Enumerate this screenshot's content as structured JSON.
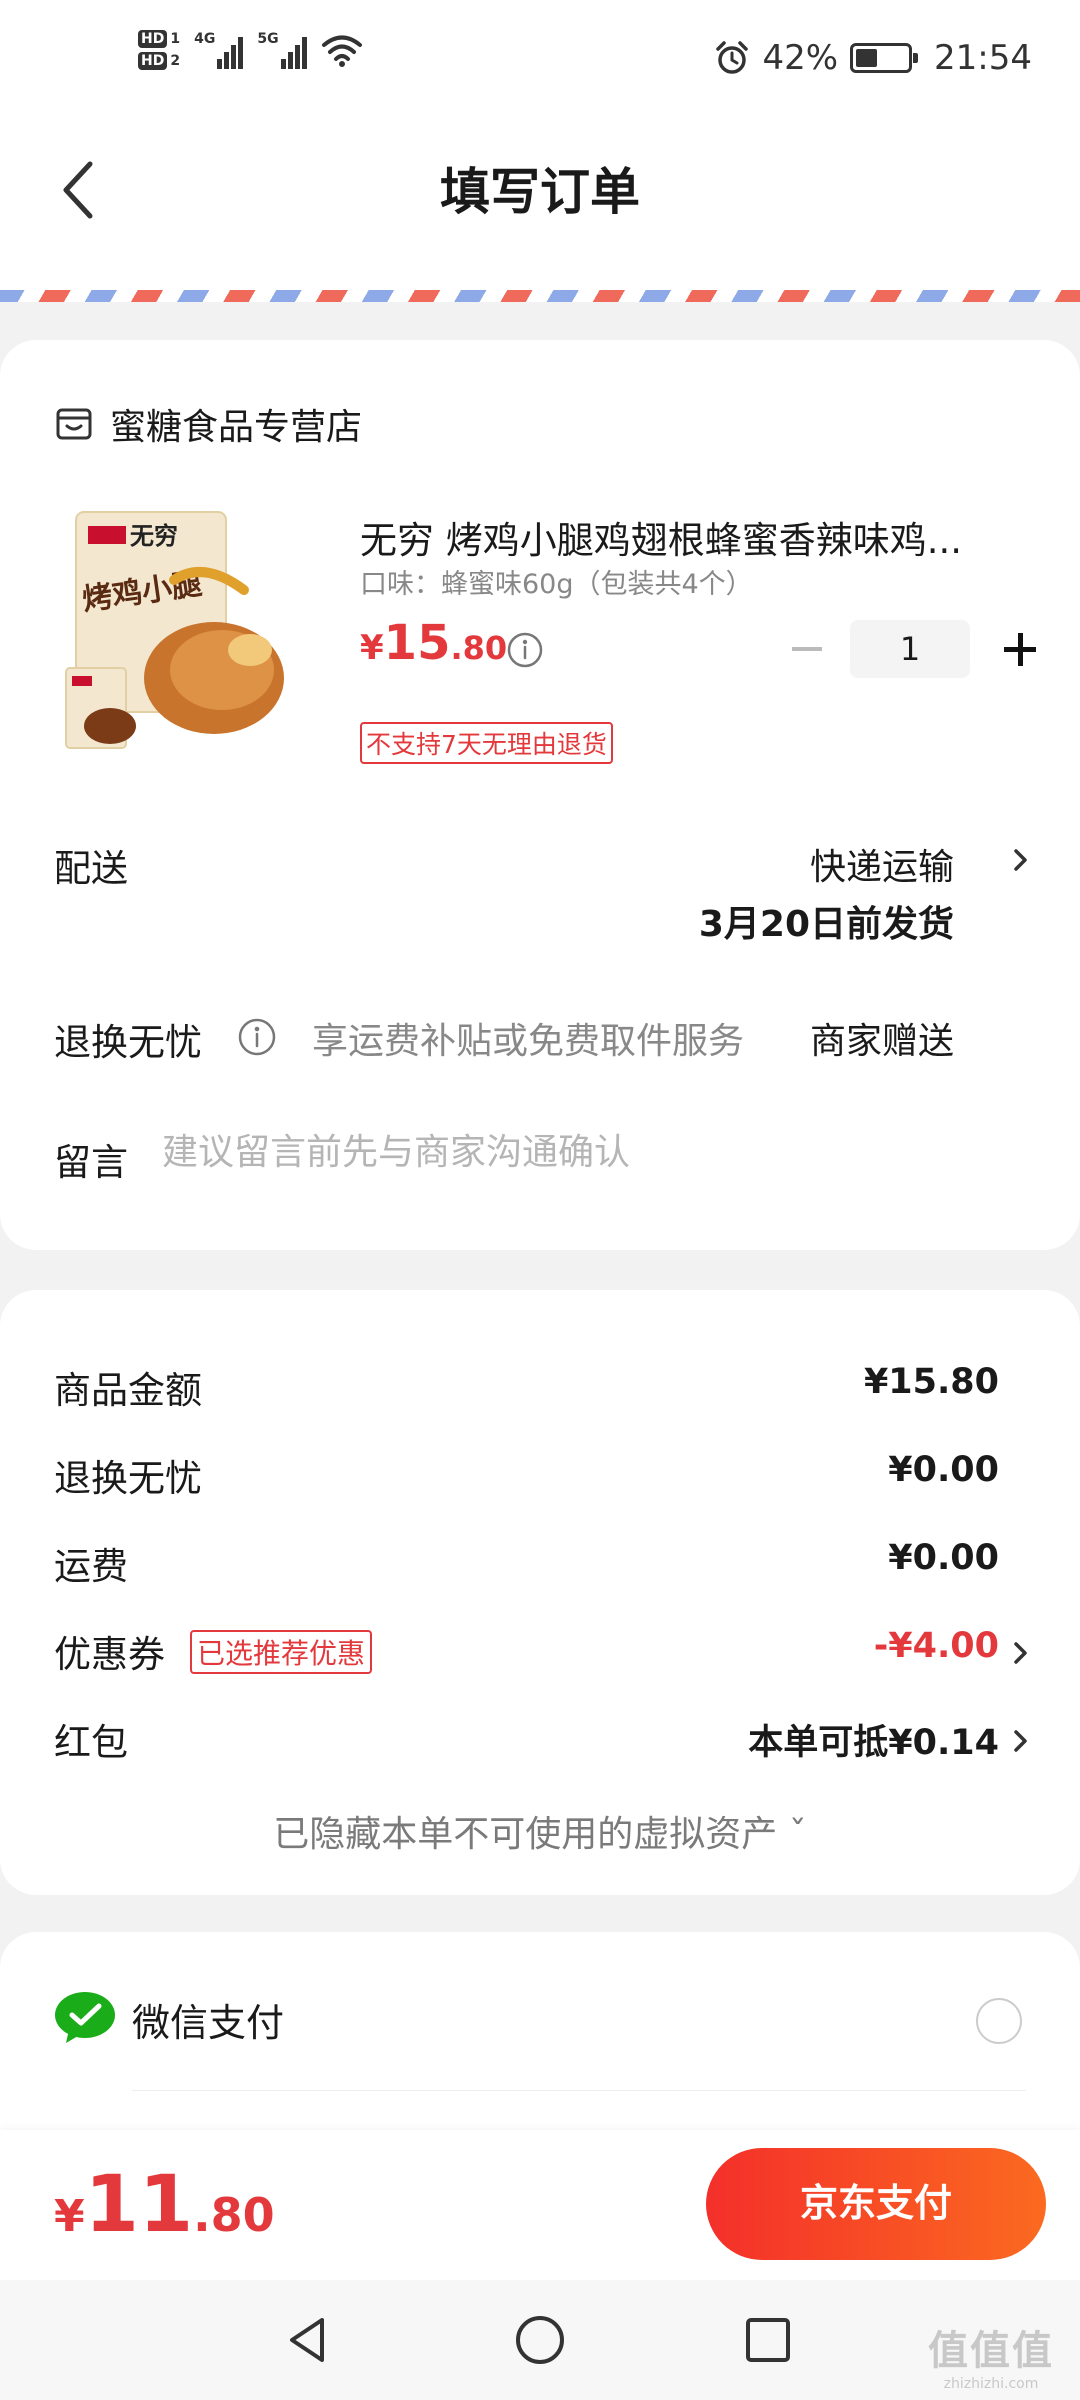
{
  "status_bar": {
    "sim1": "HD",
    "sim1_num": "1",
    "sim2": "HD",
    "sim2_num": "2",
    "network1": "4G",
    "network2": "5G",
    "battery_percent": "42%",
    "battery_level": 0.42,
    "time": "21:54",
    "icons": [
      "alarm-icon",
      "wifi-icon",
      "battery-icon",
      "signal-icon"
    ]
  },
  "header": {
    "title": "填写订单",
    "back_icon": "chevron-left-icon"
  },
  "shop": {
    "name": "蜜糖食品专营店",
    "icon": "store-icon",
    "product": {
      "title": "无穷 烤鸡小腿鸡翅根蜂蜜香辣味鸡...",
      "spec": "口味：蜂蜜味60g（包装共4个）",
      "price_currency": "¥",
      "price_int": "15",
      "price_dec": ".80",
      "quantity": "1",
      "return_note": "不支持7天无理由退货",
      "image_brand": "无穷",
      "image_name": "烤鸡小腿"
    },
    "delivery": {
      "label": "配送",
      "method": "快递运输",
      "date": "3月20日前发货"
    },
    "return_service": {
      "label": "退换无忧",
      "desc": "享运费补贴或免费取件服务",
      "value": "商家赠送"
    },
    "remark": {
      "label": "留言",
      "placeholder": "建议留言前先与商家沟通确认"
    }
  },
  "price_summary": {
    "rows": [
      {
        "label": "商品金额",
        "value": "¥15.80"
      },
      {
        "label": "退换无忧",
        "value": "¥0.00"
      },
      {
        "label": "运费",
        "value": "¥0.00"
      },
      {
        "label": "优惠券",
        "badge": "已选推荐优惠",
        "value": "-¥4.00"
      },
      {
        "label": "红包",
        "value": "本单可抵¥0.14"
      }
    ],
    "hidden_assets": "已隐藏本单不可使用的虚拟资产 ˇ"
  },
  "payment": {
    "method": "微信支付",
    "icon": "wechat-icon"
  },
  "bottom": {
    "total_currency": "¥",
    "total_int": "11",
    "total_dec": ".80",
    "pay_button": "京东支付"
  },
  "colors": {
    "accent": "#e4393c",
    "pay_gradient_start": "#f42f2a",
    "pay_gradient_end": "#fb6a20",
    "wechat_green": "#1aad19"
  },
  "watermark": {
    "logo": "值值值",
    "text": "zhizhizhi.com"
  }
}
